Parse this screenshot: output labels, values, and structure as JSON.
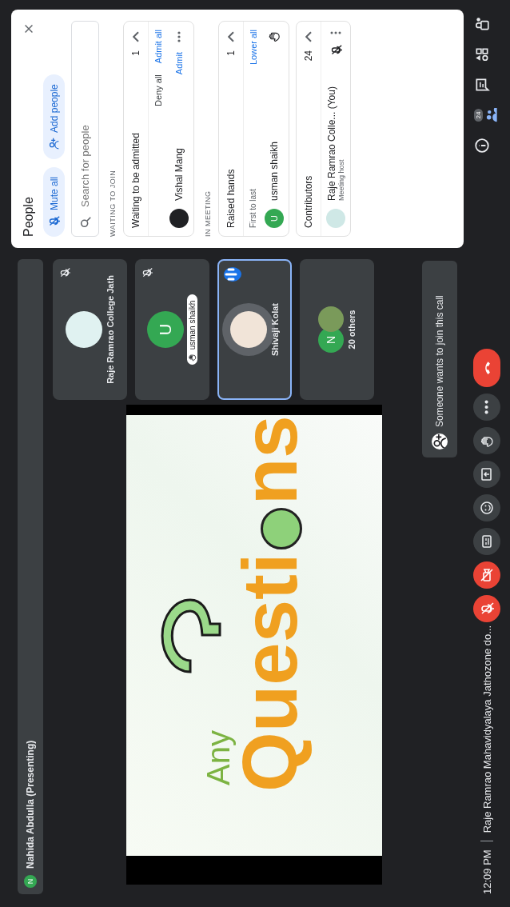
{
  "top_bar": {
    "avatar_letter": "N",
    "presenter": "Nahida Abdulla (Presenting)"
  },
  "slide": {
    "line_1": "Any",
    "title_start": "Questi",
    "title_end": "ns"
  },
  "tiles": [
    {
      "kind": "avatar",
      "name": "Raje Ramrao College Jath",
      "muted": true,
      "speaking": false
    },
    {
      "kind": "letter",
      "letter": "U",
      "name": "usman shaikh",
      "hand_raised": true,
      "muted": true,
      "speaking": false
    },
    {
      "kind": "photo",
      "name": "Shivaji Kolat",
      "muted": false,
      "speaking": true
    },
    {
      "kind": "others",
      "letter": "N",
      "name": "20 others",
      "muted": false,
      "speaking": false
    }
  ],
  "notification": {
    "text": "Someone wants to join this call"
  },
  "people_panel": {
    "title": "People",
    "buttons": [
      {
        "kind": "mute",
        "label": "Mute all"
      },
      {
        "kind": "add",
        "label": "Add people"
      }
    ],
    "search_placeholder": "Search for people",
    "waiting_heading": "WAITING TO JOIN",
    "waiting": {
      "title": "Waiting to be admitted",
      "count": "1",
      "expanded": true,
      "actions": [
        "Deny all",
        "Admit all"
      ],
      "people": [
        {
          "name": "Vishal Mang",
          "action": "Admit"
        }
      ]
    },
    "in_meeting_heading": "IN MEETING",
    "raised": {
      "title": "Raised hands",
      "count": "1",
      "expanded": true,
      "order_label": "First to last",
      "action": "Lower all",
      "people": [
        {
          "letter": "U",
          "name": "usman shaikh"
        }
      ]
    },
    "contributors": {
      "title": "Contributors",
      "count": "24",
      "expanded": true,
      "people": [
        {
          "name": "Raje Ramrao Colle... (You)",
          "role": "Meeting host",
          "muted": true
        }
      ]
    }
  },
  "bottom_bar": {
    "time": "12:09 PM",
    "meeting_name": "Raje Ramrao Mahavidyalaya Jathozone do...",
    "controls": [
      {
        "kind": "mic",
        "off": true
      },
      {
        "kind": "camera",
        "off": true
      },
      {
        "kind": "captions",
        "off": false
      },
      {
        "kind": "emoji",
        "off": false
      },
      {
        "kind": "present",
        "off": false
      },
      {
        "kind": "hand",
        "off": false
      },
      {
        "kind": "more",
        "off": false
      },
      {
        "kind": "end-call"
      }
    ],
    "side_buttons": [
      {
        "kind": "info",
        "selected": false
      },
      {
        "kind": "people",
        "selected": true,
        "badge": "24"
      },
      {
        "kind": "chat",
        "selected": false
      },
      {
        "kind": "activities",
        "selected": false
      },
      {
        "kind": "lock",
        "selected": false
      }
    ]
  }
}
